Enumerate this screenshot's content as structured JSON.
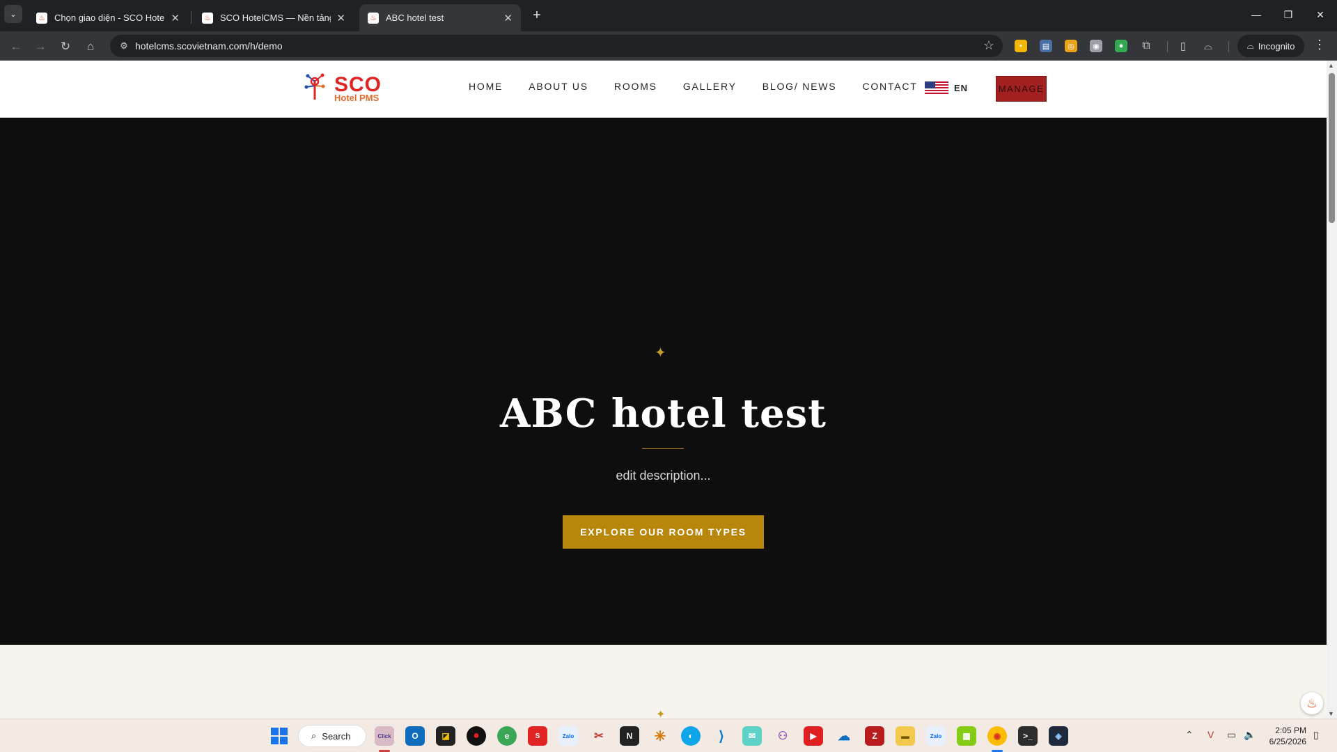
{
  "browser": {
    "tabs": [
      {
        "title": "Chọn giao diện - SCO Hotel CM",
        "active": false
      },
      {
        "title": "SCO HotelCMS — Nền tảng we",
        "active": false
      },
      {
        "title": "ABC hotel test",
        "active": true
      }
    ],
    "url": "hotelcms.scovietnam.com/h/demo",
    "incognito_label": "Incognito"
  },
  "site": {
    "logo": {
      "main": "SCO",
      "sub": "Hotel PMS"
    },
    "nav": [
      "HOME",
      "ABOUT US",
      "ROOMS",
      "GALLERY",
      "BLOG/ NEWS",
      "CONTACT"
    ],
    "language": "EN",
    "manage_label": "MANAGE"
  },
  "hero": {
    "title": "ABC hotel test",
    "description": "edit description...",
    "cta": "EXPLORE OUR ROOM TYPES"
  },
  "taskbar": {
    "search_label": "Search",
    "time": "2:05 PM",
    "date": "6/25/2026"
  },
  "colors": {
    "accent_gold": "#b8860b",
    "manage_red": "#a32020",
    "logo_red": "#e02424",
    "hero_bg": "#0e0e0f"
  }
}
